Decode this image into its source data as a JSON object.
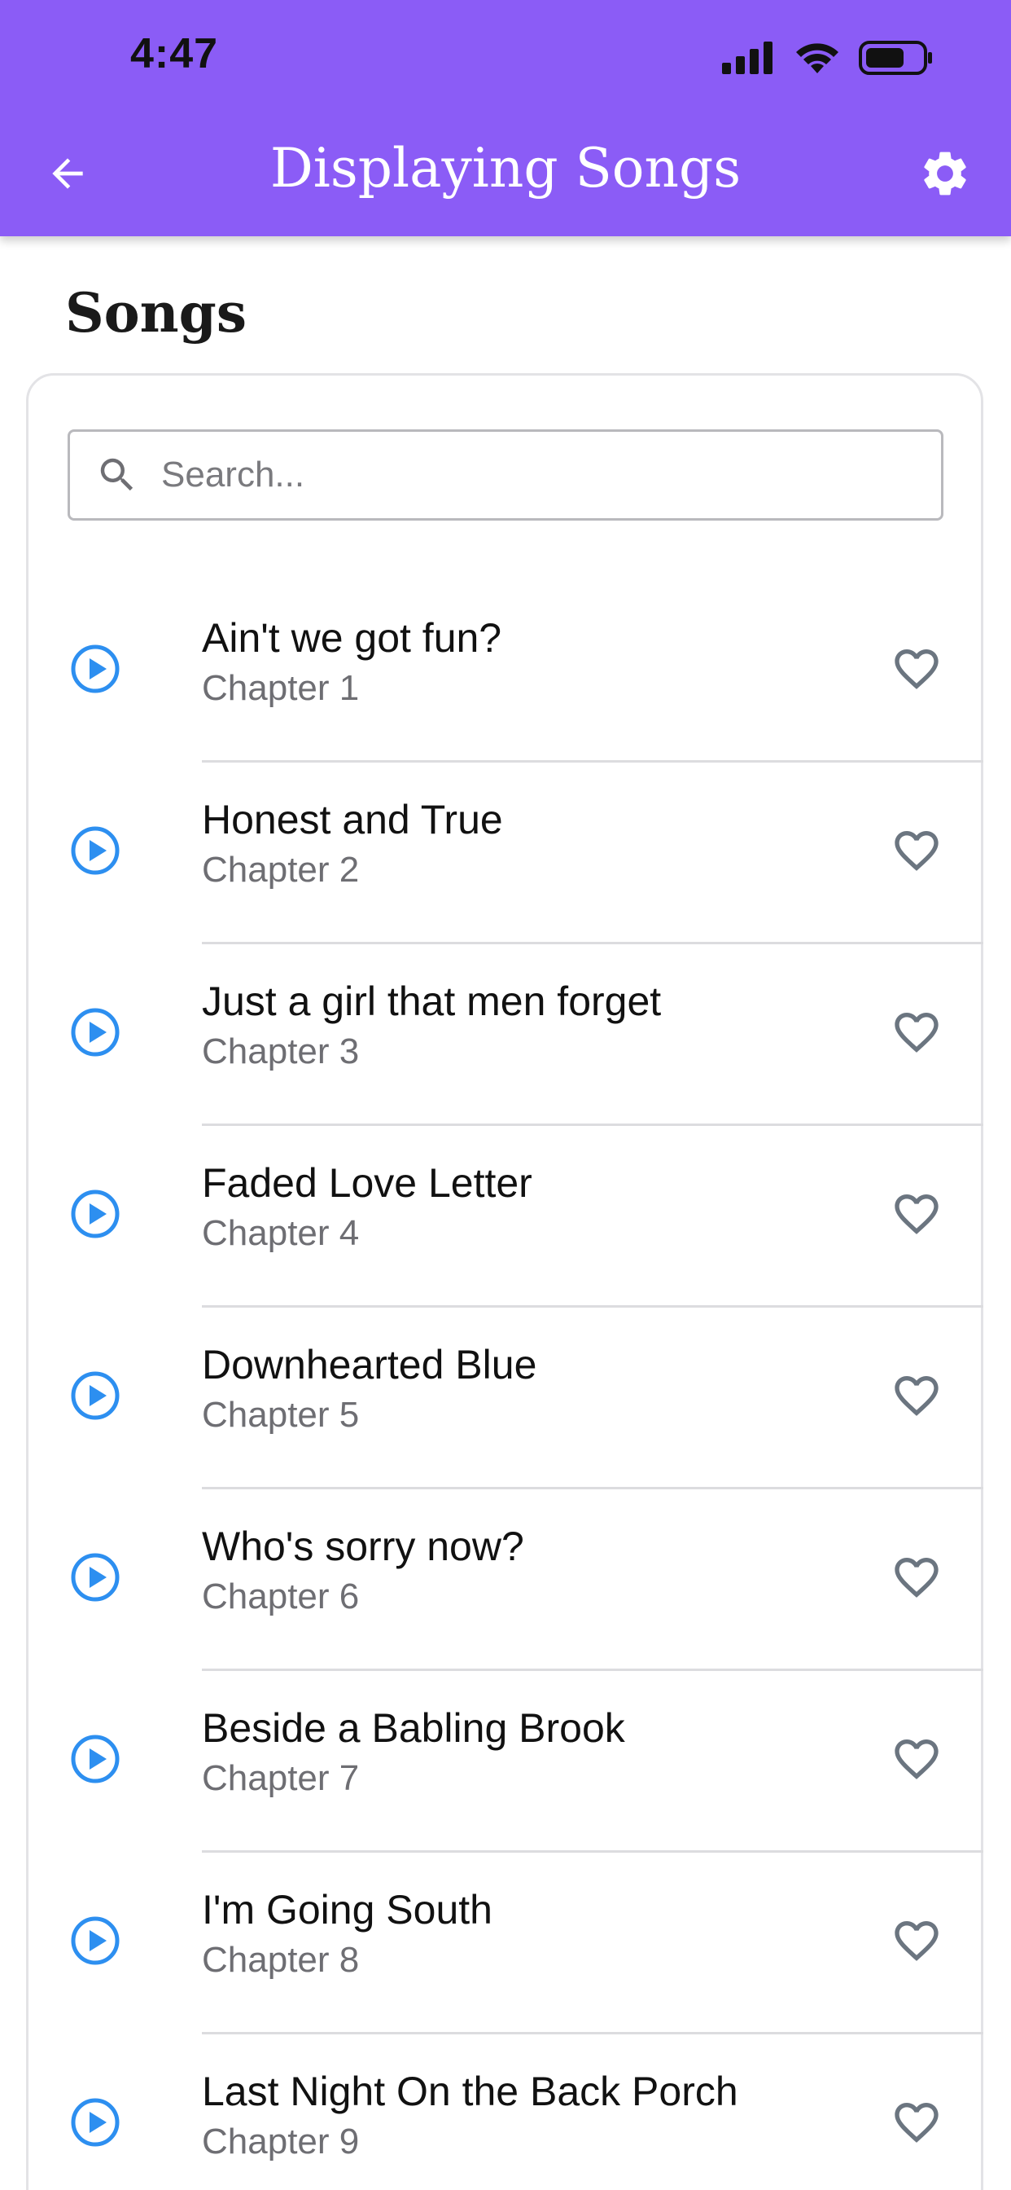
{
  "status_bar": {
    "time": "4:47"
  },
  "header": {
    "title": "Displaying Songs",
    "background_color": "#8b5cf6",
    "back_icon": "arrow-left-icon",
    "settings_icon": "gear-icon"
  },
  "section": {
    "title": "Songs"
  },
  "search": {
    "placeholder": "Search...",
    "value": ""
  },
  "colors": {
    "play_icon": "#2d8ff0",
    "heart_icon": "#6b7580"
  },
  "songs": [
    {
      "title": "Ain't we got fun?",
      "subtitle": "Chapter 1"
    },
    {
      "title": "Honest and True",
      "subtitle": "Chapter 2"
    },
    {
      "title": "Just a girl that men forget",
      "subtitle": "Chapter 3"
    },
    {
      "title": "Faded Love Letter",
      "subtitle": "Chapter 4"
    },
    {
      "title": "Downhearted Blue",
      "subtitle": "Chapter 5"
    },
    {
      "title": "Who's sorry now?",
      "subtitle": "Chapter 6"
    },
    {
      "title": "Beside a Babling Brook",
      "subtitle": "Chapter 7"
    },
    {
      "title": "I'm Going South",
      "subtitle": "Chapter 8"
    },
    {
      "title": "Last Night On the Back Porch",
      "subtitle": "Chapter 9"
    }
  ]
}
